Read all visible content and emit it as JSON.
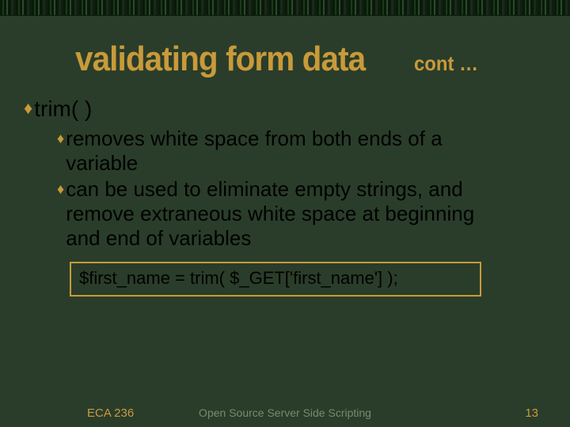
{
  "header": {
    "title": "validating form data",
    "subtitle": "cont …"
  },
  "body": {
    "item1": {
      "text": "trim( )",
      "subitems": [
        "removes white space from both ends of a variable",
        "can be used to eliminate empty strings, and remove extraneous white space at beginning and end of variables"
      ]
    },
    "code": "$first_name = trim( $_GET['first_name'] );"
  },
  "footer": {
    "left": "ECA 236",
    "center": "Open Source Server Side Scripting",
    "right": "13"
  }
}
